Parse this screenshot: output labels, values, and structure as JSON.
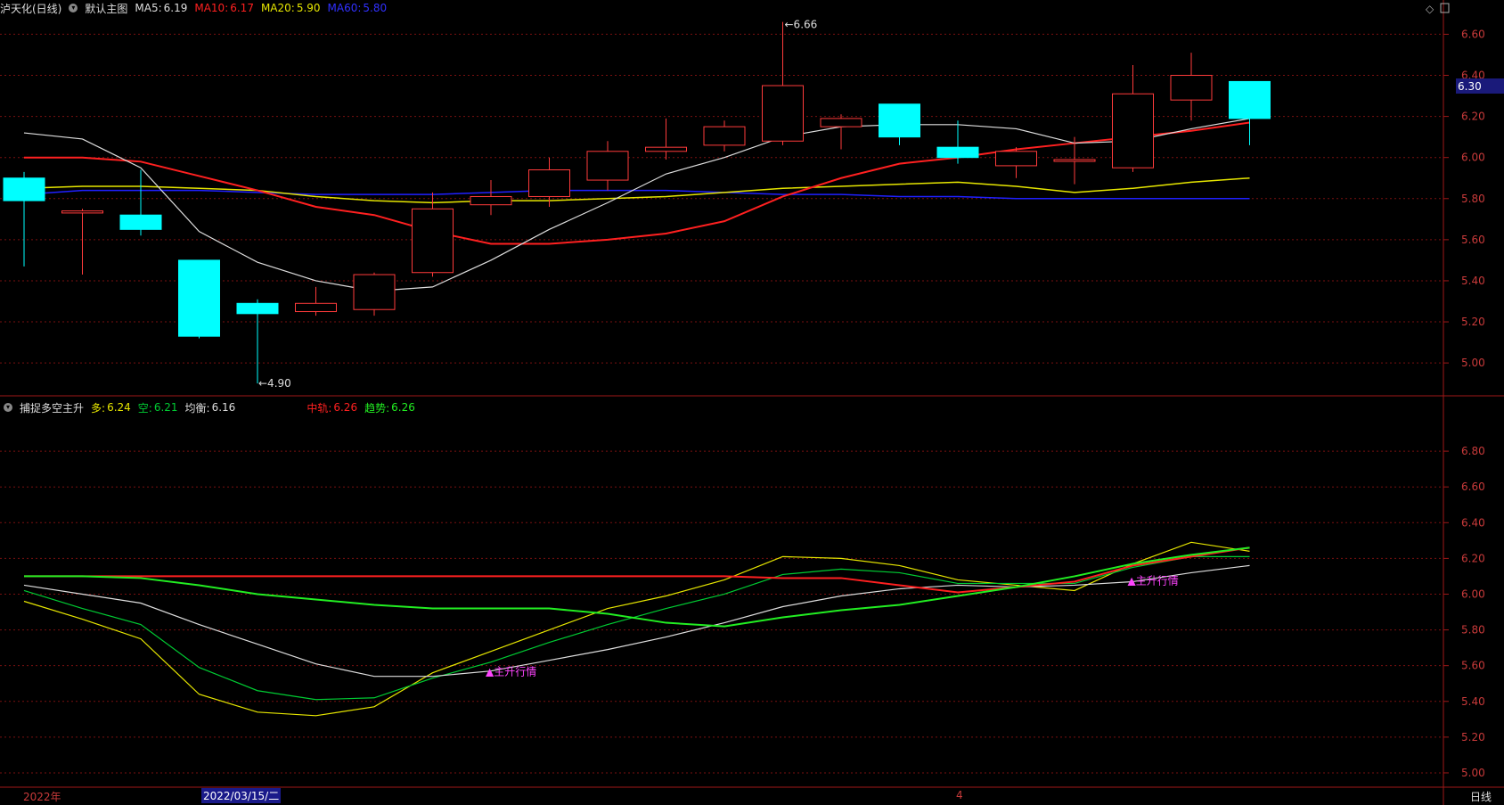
{
  "main_header": {
    "stock": "泸天化(日线)",
    "template": "默认主图",
    "ma5_label": "MA5:",
    "ma5_value": "6.19",
    "ma10_label": "MA10:",
    "ma10_value": "6.17",
    "ma20_label": "MA20:",
    "ma20_value": "5.90",
    "ma60_label": "MA60:",
    "ma60_value": "5.80"
  },
  "sub_header": {
    "indicator": "捕捉多空主升",
    "duo_label": "多:",
    "duo_value": "6.24",
    "kong_label": "空:",
    "kong_value": "6.21",
    "junheng_label": "均衡:",
    "junheng_value": "6.16",
    "zhonggui_label": "中轨:",
    "zhonggui_value": "6.26",
    "qushi_label": "趋势:",
    "qushi_value": "6.26"
  },
  "price_tag": "6.30",
  "bottom": {
    "year": "2022年",
    "date": "2022/03/15/二",
    "month": "4",
    "period": "日线"
  },
  "colors": {
    "up": "#ff3b3b",
    "down": "#00ffff",
    "ma5": "#dddddd",
    "ma10": "#ff2020",
    "ma20": "#e6e600",
    "ma60": "#2020ff",
    "grid": "#7a1010",
    "magenta": "#ff44ff"
  },
  "chart_data": [
    {
      "type": "candlestick",
      "ylim": [
        4.84,
        6.68
      ],
      "y_ticks": [
        "6.60",
        "6.40",
        "6.20",
        "6.00",
        "5.80",
        "5.60",
        "5.40",
        "5.20",
        "5.00"
      ],
      "candles": [
        {
          "o": 5.9,
          "h": 5.93,
          "l": 5.47,
          "c": 5.79
        },
        {
          "o": 5.73,
          "h": 5.75,
          "l": 5.43,
          "c": 5.74
        },
        {
          "o": 5.72,
          "h": 5.94,
          "l": 5.62,
          "c": 5.65
        },
        {
          "o": 5.5,
          "h": 5.5,
          "l": 5.12,
          "c": 5.13
        },
        {
          "o": 5.29,
          "h": 5.31,
          "l": 4.9,
          "c": 5.24
        },
        {
          "o": 5.25,
          "h": 5.37,
          "l": 5.23,
          "c": 5.29
        },
        {
          "o": 5.26,
          "h": 5.44,
          "l": 5.23,
          "c": 5.43
        },
        {
          "o": 5.44,
          "h": 5.83,
          "l": 5.42,
          "c": 5.75
        },
        {
          "o": 5.77,
          "h": 5.89,
          "l": 5.72,
          "c": 5.81
        },
        {
          "o": 5.81,
          "h": 6.0,
          "l": 5.76,
          "c": 5.94
        },
        {
          "o": 5.89,
          "h": 6.08,
          "l": 5.84,
          "c": 6.03
        },
        {
          "o": 6.03,
          "h": 6.19,
          "l": 5.99,
          "c": 6.05
        },
        {
          "o": 6.06,
          "h": 6.18,
          "l": 6.03,
          "c": 6.15
        },
        {
          "o": 6.08,
          "h": 6.66,
          "l": 6.06,
          "c": 6.35
        },
        {
          "o": 6.15,
          "h": 6.21,
          "l": 6.04,
          "c": 6.19
        },
        {
          "o": 6.26,
          "h": 6.26,
          "l": 6.06,
          "c": 6.1
        },
        {
          "o": 6.05,
          "h": 6.18,
          "l": 5.97,
          "c": 6.0
        },
        {
          "o": 5.96,
          "h": 6.05,
          "l": 5.9,
          "c": 6.03
        },
        {
          "o": 5.99,
          "h": 6.1,
          "l": 5.87,
          "c": 5.99
        },
        {
          "o": 5.95,
          "h": 6.45,
          "l": 5.93,
          "c": 6.31
        },
        {
          "o": 6.28,
          "h": 6.51,
          "l": 6.18,
          "c": 6.4
        },
        {
          "o": 6.37,
          "h": 6.37,
          "l": 6.06,
          "c": 6.19
        }
      ],
      "ma5": [
        6.12,
        6.09,
        5.95,
        5.64,
        5.49,
        5.4,
        5.35,
        5.37,
        5.5,
        5.65,
        5.78,
        5.92,
        6.0,
        6.1,
        6.15,
        6.16,
        6.16,
        6.14,
        6.07,
        6.08,
        6.14,
        6.19
      ],
      "ma10": [
        6.0,
        6.0,
        5.98,
        5.91,
        5.84,
        5.76,
        5.72,
        5.64,
        5.58,
        5.58,
        5.6,
        5.63,
        5.69,
        5.81,
        5.9,
        5.97,
        6.0,
        6.04,
        6.07,
        6.1,
        6.13,
        6.17
      ],
      "ma20": [
        5.85,
        5.86,
        5.86,
        5.85,
        5.84,
        5.81,
        5.79,
        5.78,
        5.79,
        5.79,
        5.8,
        5.81,
        5.83,
        5.85,
        5.86,
        5.87,
        5.88,
        5.86,
        5.83,
        5.85,
        5.88,
        5.9
      ],
      "ma60": [
        5.82,
        5.84,
        5.84,
        5.84,
        5.83,
        5.82,
        5.82,
        5.82,
        5.83,
        5.84,
        5.84,
        5.84,
        5.83,
        5.82,
        5.82,
        5.81,
        5.81,
        5.8,
        5.8,
        5.8,
        5.8,
        5.8
      ],
      "markers": {
        "high": "6.66",
        "low": "4.90"
      }
    },
    {
      "type": "line",
      "ylim": [
        4.92,
        7.0
      ],
      "y_ticks": [
        "6.80",
        "6.60",
        "6.40",
        "6.20",
        "6.00",
        "5.80",
        "5.60",
        "5.40",
        "5.20",
        "5.00"
      ],
      "series": [
        {
          "name": "多",
          "color": "#e6e600",
          "values": [
            5.96,
            5.86,
            5.75,
            5.44,
            5.34,
            5.32,
            5.37,
            5.56,
            5.68,
            5.8,
            5.92,
            5.99,
            6.08,
            6.21,
            6.2,
            6.16,
            6.08,
            6.05,
            6.02,
            6.17,
            6.29,
            6.24
          ]
        },
        {
          "name": "空",
          "color": "#00cc33",
          "values": [
            6.02,
            5.92,
            5.83,
            5.59,
            5.46,
            5.41,
            5.42,
            5.53,
            5.62,
            5.73,
            5.83,
            5.92,
            6.0,
            6.11,
            6.14,
            6.12,
            6.06,
            6.06,
            6.06,
            6.15,
            6.21,
            6.21
          ]
        },
        {
          "name": "均衡",
          "color": "#dddddd",
          "values": [
            6.05,
            6.0,
            5.95,
            5.83,
            5.72,
            5.61,
            5.54,
            5.54,
            5.57,
            5.63,
            5.69,
            5.76,
            5.84,
            5.93,
            5.99,
            6.03,
            6.05,
            6.04,
            6.05,
            6.07,
            6.12,
            6.16
          ]
        },
        {
          "name": "中轨",
          "color": "#ff2020",
          "values": [
            6.1,
            6.1,
            6.1,
            6.1,
            6.1,
            6.1,
            6.1,
            6.1,
            6.1,
            6.1,
            6.1,
            6.1,
            6.1,
            6.09,
            6.09,
            6.05,
            6.01,
            6.04,
            6.07,
            6.16,
            6.21,
            6.26
          ]
        },
        {
          "name": "趋势",
          "color": "#22ee22",
          "values": [
            6.1,
            6.1,
            6.09,
            6.05,
            6.0,
            5.97,
            5.94,
            5.92,
            5.92,
            5.92,
            5.89,
            5.84,
            5.82,
            5.87,
            5.91,
            5.94,
            5.99,
            6.04,
            6.1,
            6.17,
            6.22,
            6.26
          ]
        }
      ],
      "signals": [
        {
          "label": "主升行情",
          "index": 8,
          "value": 5.57
        },
        {
          "label": "主升行情",
          "index": 19,
          "value": 6.08
        }
      ]
    }
  ]
}
